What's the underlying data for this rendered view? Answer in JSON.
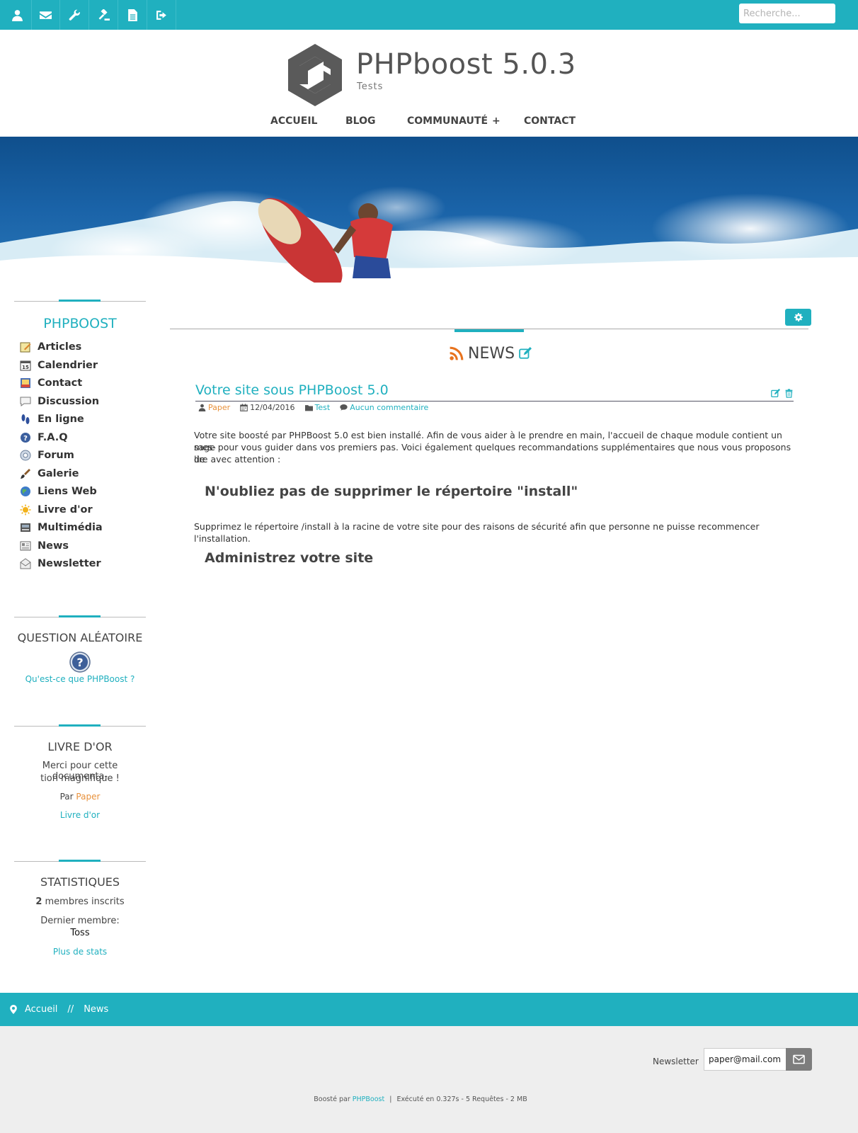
{
  "topbar": {
    "icons": [
      "user-icon",
      "envelope-icon",
      "wrench-icon",
      "gavel-icon",
      "file-icon",
      "sign-out-icon"
    ],
    "search_placeholder": "Recherche..."
  },
  "header": {
    "title": "PHPboost 5.0.3",
    "subtitle": "Tests"
  },
  "nav": {
    "items": [
      "ACCUEIL",
      "BLOG",
      "COMMUNAUTÉ",
      "CONTACT"
    ],
    "plus": "+"
  },
  "sidebar": {
    "menu_title": "PHPBOOST",
    "links": [
      "Articles",
      "Calendrier",
      "Contact",
      "Discussion",
      "En ligne",
      "F.A.Q",
      "Forum",
      "Galerie",
      "Liens Web",
      "Livre d'or",
      "Multimédia",
      "News",
      "Newsletter"
    ],
    "question": {
      "title": "QUESTION ALÉATOIRE",
      "link": "Qu'est-ce que PHPBoost ?"
    },
    "guestbook": {
      "title": "LIVRE D'OR",
      "message_line1": "Merci pour cette documenta-",
      "message_line2": "tion magnifique !",
      "by": "Par",
      "author": "Paper",
      "link": "Livre d'or"
    },
    "stats": {
      "title": "STATISTIQUES",
      "count": "2",
      "members_label": "membres inscrits",
      "last_member_label": "Dernier membre:",
      "last_member": "Toss",
      "link": "Plus de stats"
    }
  },
  "main": {
    "section_title": "NEWS",
    "article": {
      "title": "Votre site sous PHPBoost 5.0",
      "author": "Paper",
      "date": "12/04/2016",
      "category": "Test",
      "comments": "Aucun commentaire",
      "intro_line1": "Votre site boosté par PHPBoost 5.0 est bien installé. Afin de vous aider à le prendre en main, l'accueil de chaque module contient un mes-",
      "intro_line2": "sage pour vous guider dans vos premiers pas. Voici également quelques recommandations supplémentaires que nous vous proposons de",
      "intro_line3": "lire avec attention :",
      "heading1": "N'oubliez pas de supprimer le répertoire \"install\"",
      "paragraph2": "Supprimez le répertoire /install à la racine de votre site pour des raisons de sécurité afin que personne ne puisse recommencer l'installation.",
      "heading2": "Administrez votre site"
    }
  },
  "breadcrumb": {
    "home": "Accueil",
    "separator": "//",
    "current": "News"
  },
  "footer": {
    "newsletter_label": "Newsletter",
    "newsletter_value": "paper@mail.com",
    "credits_prefix": "Boosté par",
    "credits_link": "PHPBoost",
    "credits_sep": "|",
    "credits_suffix": "Exécuté en 0.327s - 5 Requêtes - 2 MB"
  },
  "colors": {
    "accent": "#20b0bf",
    "author_link": "#e8913b",
    "rss": "#e8731e"
  }
}
